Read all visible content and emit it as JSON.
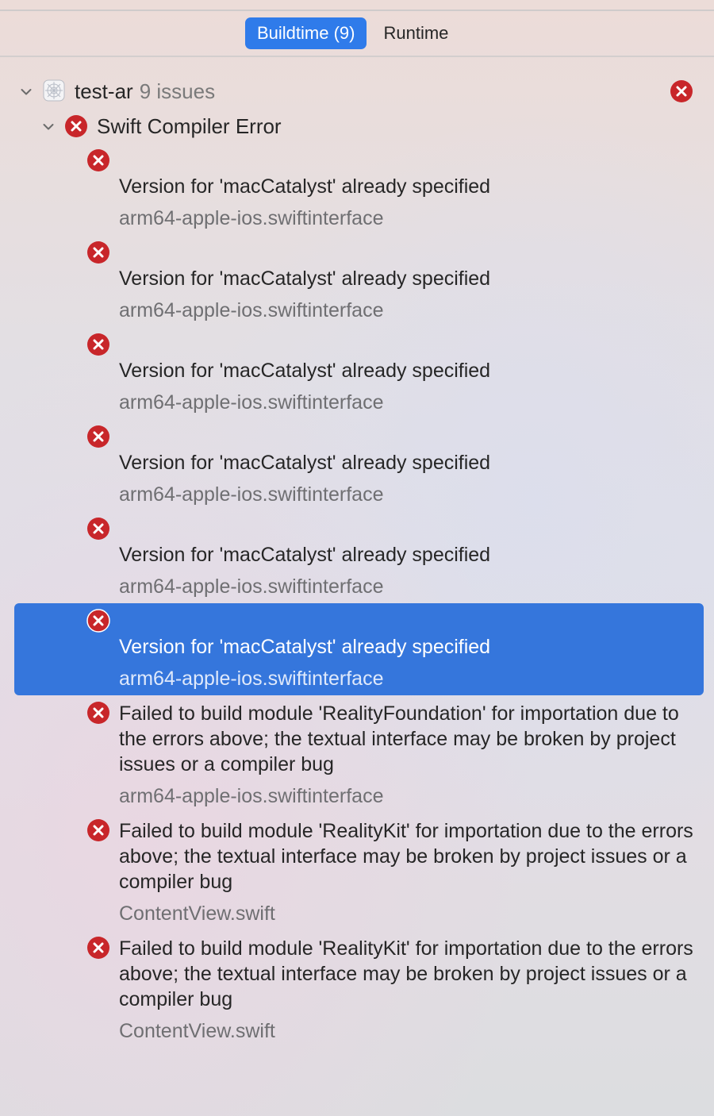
{
  "tabs": [
    {
      "label": "Buildtime (9)",
      "active": true
    },
    {
      "label": "Runtime",
      "active": false
    }
  ],
  "project": {
    "name": "test-ar",
    "issue_count": "9 issues",
    "icon": "app-project-icon"
  },
  "group": {
    "title": "Swift Compiler Error"
  },
  "issues": [
    {
      "message": "Version for 'macCatalyst' already specified",
      "file": "arm64-apple-ios.swiftinterface",
      "selected": false
    },
    {
      "message": "Version for 'macCatalyst' already specified",
      "file": "arm64-apple-ios.swiftinterface",
      "selected": false
    },
    {
      "message": "Version for 'macCatalyst' already specified",
      "file": "arm64-apple-ios.swiftinterface",
      "selected": false
    },
    {
      "message": "Version for 'macCatalyst' already specified",
      "file": "arm64-apple-ios.swiftinterface",
      "selected": false
    },
    {
      "message": "Version for 'macCatalyst' already specified",
      "file": "arm64-apple-ios.swiftinterface",
      "selected": false
    },
    {
      "message": "Version for 'macCatalyst' already specified",
      "file": "arm64-apple-ios.swiftinterface",
      "selected": true
    },
    {
      "message": "Failed to build module 'RealityFoundation' for importation due to the errors above; the textual interface may be broken by project issues or a compiler bug",
      "file": "arm64-apple-ios.swiftinterface",
      "selected": false
    },
    {
      "message": "Failed to build module 'RealityKit' for importation due to the errors above; the textual interface may be broken by project issues or a compiler bug",
      "file": "ContentView.swift",
      "selected": false
    },
    {
      "message": "Failed to build module 'RealityKit' for importation due to the errors above; the textual interface may be broken by project issues or a compiler bug",
      "file": "ContentView.swift",
      "selected": false
    }
  ],
  "colors": {
    "accent": "#2f7bea",
    "selection": "#3576dc",
    "error_red": "#c8262a"
  }
}
